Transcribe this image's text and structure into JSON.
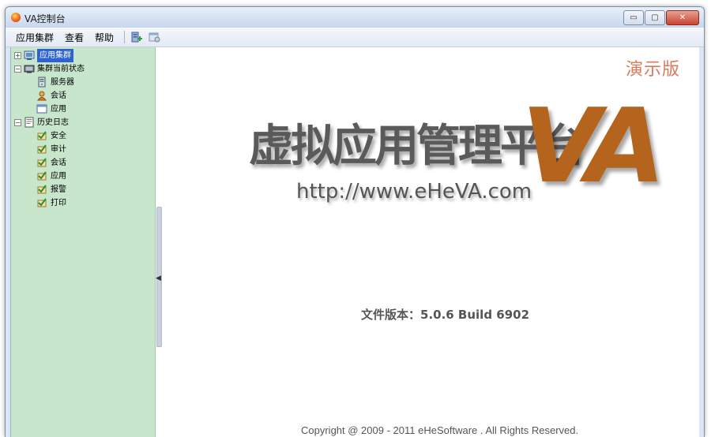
{
  "window": {
    "title": "VA控制台",
    "buttons": {
      "minimize": "▭",
      "restore": "▢",
      "close": "✕"
    }
  },
  "menubar": {
    "items": [
      "应用集群",
      "查看",
      "帮助"
    ],
    "toolbar_icons": [
      "add-server-icon",
      "properties-icon"
    ]
  },
  "sidebar": {
    "tree": [
      {
        "label": "应用集群",
        "level": 0,
        "expander": "+",
        "icon": "cluster-icon",
        "selected": true
      },
      {
        "label": "集群当前状态",
        "level": 0,
        "expander": "−",
        "icon": "monitor-icon"
      },
      {
        "label": "服务器",
        "level": 1,
        "icon": "server-icon"
      },
      {
        "label": "会话",
        "level": 1,
        "icon": "session-icon"
      },
      {
        "label": "应用",
        "level": 1,
        "icon": "application-icon"
      },
      {
        "label": "历史日志",
        "level": 0,
        "expander": "−",
        "icon": "log-book-icon"
      },
      {
        "label": "安全",
        "level": 1,
        "icon": "log-entry-icon"
      },
      {
        "label": "审计",
        "level": 1,
        "icon": "log-entry-icon"
      },
      {
        "label": "会话",
        "level": 1,
        "icon": "log-entry-icon"
      },
      {
        "label": "应用",
        "level": 1,
        "icon": "log-entry-icon"
      },
      {
        "label": "报警",
        "level": 1,
        "icon": "log-entry-icon"
      },
      {
        "label": "打印",
        "level": 1,
        "icon": "log-entry-icon"
      }
    ]
  },
  "main": {
    "demo_badge": "演示版",
    "logo_cn": "虚拟应用管理平台",
    "logo_va": "VA",
    "logo_url": "http://www.eHeVA.com",
    "version": "文件版本：5.0.6 Build 6902",
    "copyright": "Copyright @ 2009 - 2011 eHeSoftware . All Rights Reserved."
  },
  "colors": {
    "sidebar_bg": "#c8e6cc",
    "selected_bg": "#2c63d1",
    "va_brand": "#b4641c",
    "demo_badge": "#d87a5a"
  }
}
